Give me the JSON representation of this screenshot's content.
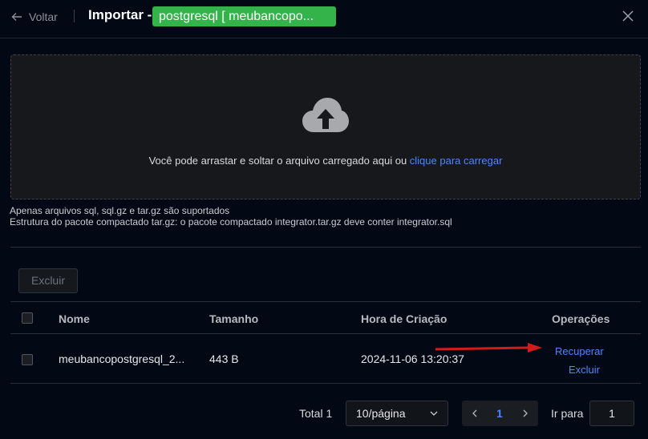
{
  "header": {
    "back_label": "Voltar",
    "title": "Importar -",
    "database_badge": "postgresql [ meubancopo..."
  },
  "upload": {
    "text": "Você pode arrastar e soltar o arquivo carregado aqui ou ",
    "link": "clique para carregar",
    "hint_formats": "Apenas arquivos sql, sql.gz e tar.gz são suportados",
    "hint_package": "Estrutura do pacote compactado tar.gz: o pacote compactado integrator.tar.gz deve conter integrator.sql"
  },
  "toolbar": {
    "delete_label": "Excluir"
  },
  "table": {
    "columns": [
      "Nome",
      "Tamanho",
      "Hora de Criação",
      "Operações"
    ],
    "rows": [
      {
        "name": "meubancopostgresql_2...",
        "size": "443 B",
        "created": "2024-11-06 13:20:37",
        "actions": [
          "Recuperar",
          "Excluir"
        ]
      }
    ]
  },
  "pagination": {
    "total": "Total 1",
    "page_size": "10/página",
    "current_page": "1",
    "goto_label": "Ir para",
    "goto_value": "1"
  },
  "colors": {
    "background": "#030914",
    "badge": "#34b34a",
    "link": "#4a87ff",
    "annotation_arrow": "#d01c1c"
  },
  "icons": [
    "arrow-left-icon",
    "close-icon",
    "cloud-upload-icon",
    "chevron-down-icon",
    "chevron-left-icon",
    "chevron-right-icon"
  ]
}
